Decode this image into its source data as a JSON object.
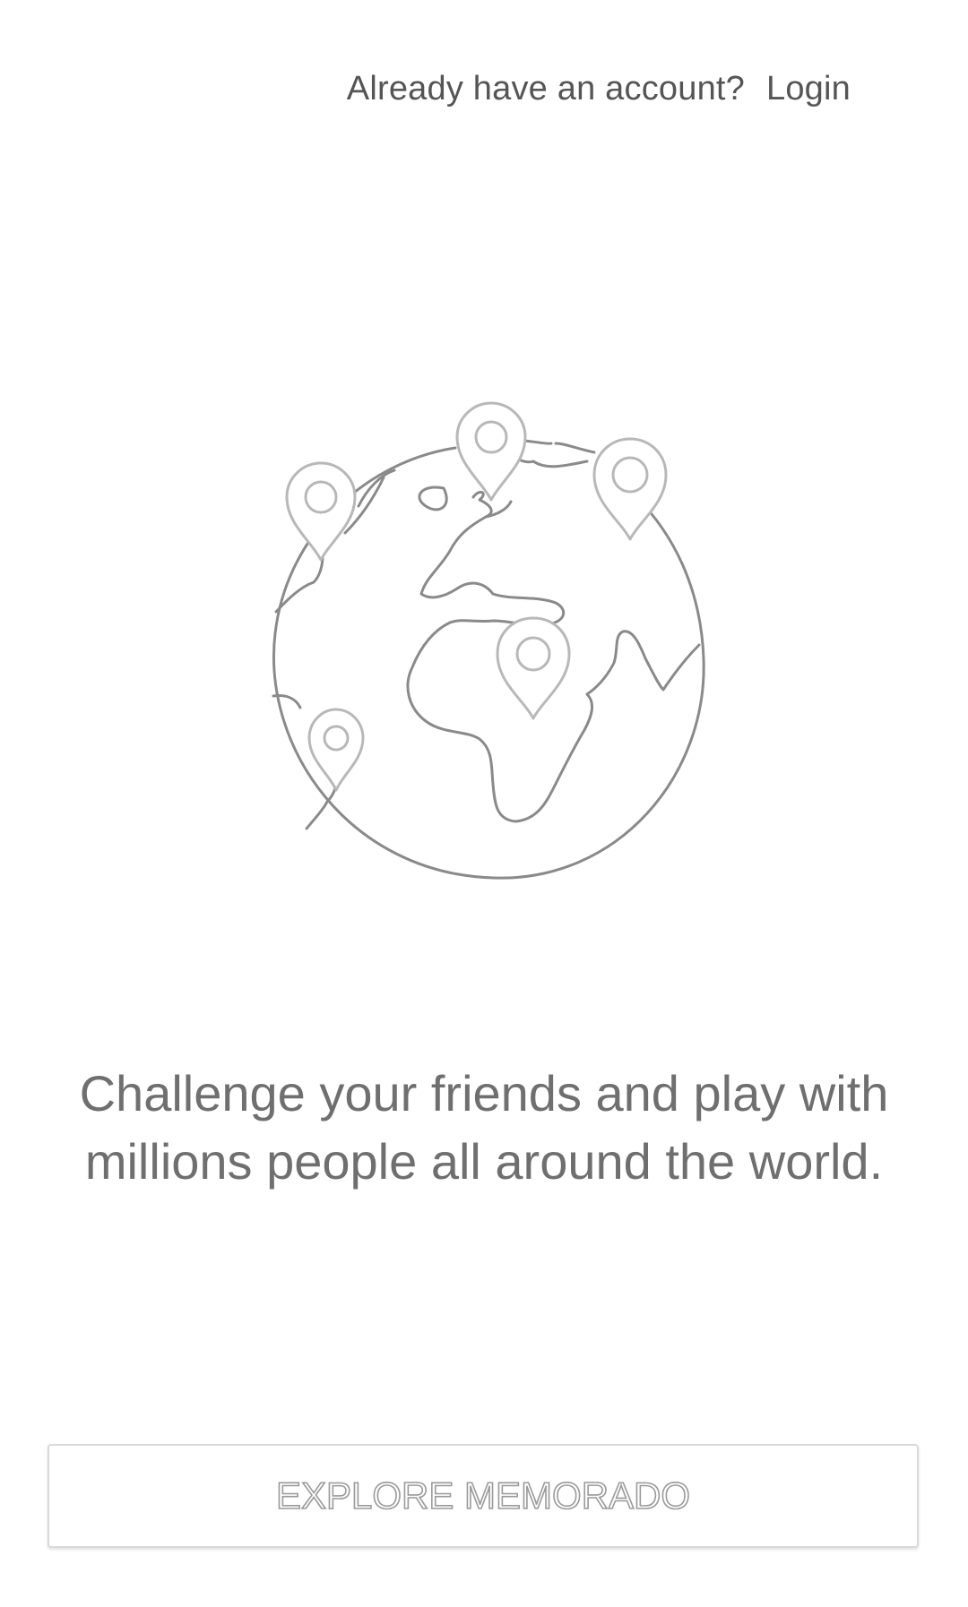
{
  "header": {
    "question": "Already have an account?",
    "login_label": "Login"
  },
  "illustration": {
    "icon": "globe-with-map-pins-icon"
  },
  "tagline": {
    "line1": "Challenge your friends and play with",
    "line2": "millions people all around the world."
  },
  "actions": {
    "explore_label": "EXPLORE MEMORADO"
  },
  "colors": {
    "text": "#6f6f6f",
    "outline": "#8a8a8a",
    "button_border": "#d9d9d9"
  }
}
